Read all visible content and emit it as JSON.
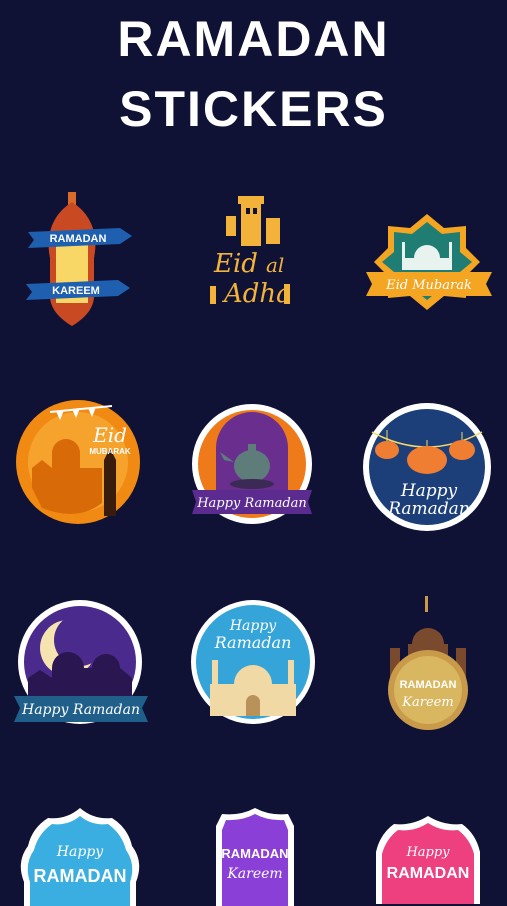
{
  "header": {
    "line1": "RAMADAN",
    "line2": "STICKERS"
  },
  "stickers": [
    {
      "id": "ramadan-kareem-lantern",
      "l1": "RAMADAN",
      "l2": "KAREEM",
      "colors": {
        "lantern": "#c94a22",
        "ribbon": "#1f5fb0"
      }
    },
    {
      "id": "eid-al-adha",
      "l1": "Eid",
      "l2": "al",
      "l3": "Adha",
      "colors": {
        "gold": "#f3b23a"
      }
    },
    {
      "id": "eid-mubarak-star",
      "l1": "Eid Mubarak",
      "colors": {
        "teal": "#1f7d74",
        "gold": "#f4a521"
      }
    },
    {
      "id": "eid-mubarak-orange",
      "l1": "Eid",
      "l2": "MUBARAK",
      "colors": {
        "orange": "#f18a12"
      }
    },
    {
      "id": "happy-ramadan-teapot",
      "l1": "Happy Ramadan",
      "colors": {
        "orange": "#ef7a1a",
        "purple": "#5b2b8f"
      }
    },
    {
      "id": "happy-ramadan-lanterns",
      "l1": "Happy",
      "l2": "Ramadan",
      "colors": {
        "blue": "#1c3f7a",
        "lantern": "#ef7d32"
      }
    },
    {
      "id": "happy-ramadan-moon",
      "l1": "Happy Ramadan",
      "colors": {
        "purple": "#4a2a8c",
        "ribbon": "#1f5f8a"
      }
    },
    {
      "id": "happy-ramadan-mosque",
      "l1": "Happy",
      "l2": "Ramadan",
      "colors": {
        "sky": "#35a4d8",
        "mosque": "#f1d9a6"
      }
    },
    {
      "id": "ramadan-kareem-badge",
      "l1": "RAMADAN",
      "l2": "Kareem",
      "colors": {
        "brown": "#7a4a2e",
        "gold": "#d9b660"
      }
    },
    {
      "id": "happy-ramadan-blue",
      "l1": "Happy",
      "l2": "RAMADAN",
      "colors": {
        "cyan": "#3aaee0"
      }
    },
    {
      "id": "ramadan-kareem-violet",
      "l1": "RAMADAN",
      "l2": "Kareem",
      "colors": {
        "violet": "#8a3fd6"
      }
    },
    {
      "id": "happy-ramadan-pink",
      "l1": "Happy",
      "l2": "RAMADAN",
      "colors": {
        "pink": "#ee3f7e"
      }
    }
  ]
}
